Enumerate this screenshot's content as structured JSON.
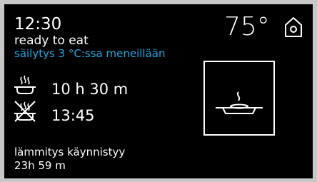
{
  "header": {
    "time": "12:30",
    "status": "ready to eat",
    "holding_status": "säilytys 3 °C:ssa meneillään",
    "temperature": "75°",
    "home_icon": "home-icon"
  },
  "schedule": {
    "cooking_duration": "10 h 30 m",
    "cooking_icon": "cooking-pot-icon",
    "ready_time": "13:45",
    "ready_icon": "crossed-pot-icon"
  },
  "program": {
    "icon": "steaming-dish-icon"
  },
  "heating": {
    "label": "lämmitys käynnistyy",
    "countdown": "23h 59 m"
  },
  "colors": {
    "background": "#000000",
    "text": "#ffffff",
    "accent": "#1ea8e6",
    "frame": "#c8c8c8"
  }
}
